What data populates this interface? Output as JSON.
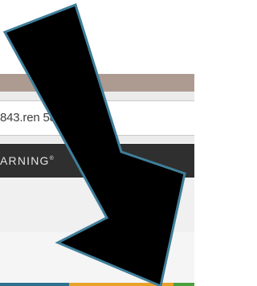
{
  "browser": {
    "url_visible": "843.ren          58930/Staf"
  },
  "navbar": {
    "brand_text": "ARNING",
    "brand_mark": "®"
  },
  "overlay": {
    "arrow_color": "#000000",
    "arrow_outline": "#3f7f9a"
  },
  "colors": {
    "titlebar": "#ad9b92",
    "navbar": "#2f2f2f",
    "bar_blue": "#2f6f8f",
    "bar_orange": "#e8a12b",
    "bar_green": "#4b9f3f"
  }
}
